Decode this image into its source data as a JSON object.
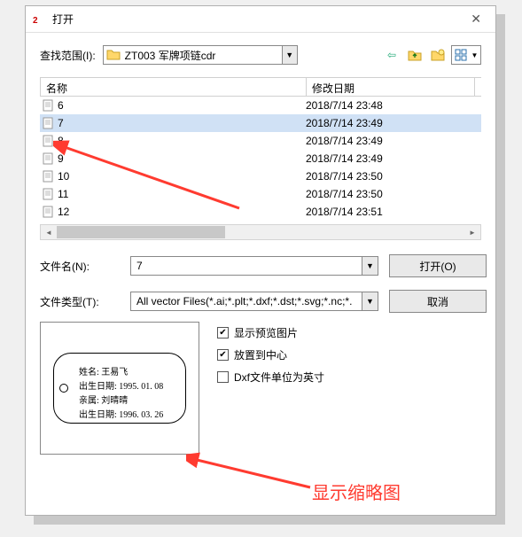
{
  "dialog": {
    "title": "打开",
    "close": "✕"
  },
  "lookin": {
    "label": "查找范围(I):",
    "folder": "ZT003 军牌项链cdr"
  },
  "nav_icons": {
    "back": "back-icon",
    "up": "up-folder-icon",
    "new_folder": "new-folder-icon",
    "view": "view-menu-icon"
  },
  "columns": {
    "name": "名称",
    "date": "修改日期"
  },
  "files": [
    {
      "name": "6",
      "date": "2018/7/14 23:48",
      "selected": false
    },
    {
      "name": "7",
      "date": "2018/7/14 23:49",
      "selected": true
    },
    {
      "name": "8",
      "date": "2018/7/14 23:49",
      "selected": false
    },
    {
      "name": "9",
      "date": "2018/7/14 23:49",
      "selected": false
    },
    {
      "name": "10",
      "date": "2018/7/14 23:50",
      "selected": false
    },
    {
      "name": "11",
      "date": "2018/7/14 23:50",
      "selected": false
    },
    {
      "name": "12",
      "date": "2018/7/14 23:51",
      "selected": false
    }
  ],
  "filename": {
    "label": "文件名(N):",
    "value": "7"
  },
  "filetype": {
    "label": "文件类型(T):",
    "value": "All vector Files(*.ai;*.plt;*.dxf;*.dst;*.svg;*.nc;*."
  },
  "buttons": {
    "open": "打开(O)",
    "cancel": "取消"
  },
  "checks": {
    "preview": "显示预览图片",
    "center": "放置到中心",
    "dxf_inch": "Dxf文件单位为英寸"
  },
  "checks_state": {
    "preview": true,
    "center": true,
    "dxf_inch": false
  },
  "preview_tag": {
    "l1": "姓名: 王易飞",
    "l2": "出生日期: 1995. 01. 08",
    "l3": "亲属: 刘晴晴",
    "l4": "出生日期: 1996. 03. 26"
  },
  "annotation": {
    "text": "显示缩略图"
  },
  "glyphs": {
    "dropdown": "▼",
    "check": "✔",
    "left": "◄",
    "right": "►",
    "back": "⇦"
  }
}
